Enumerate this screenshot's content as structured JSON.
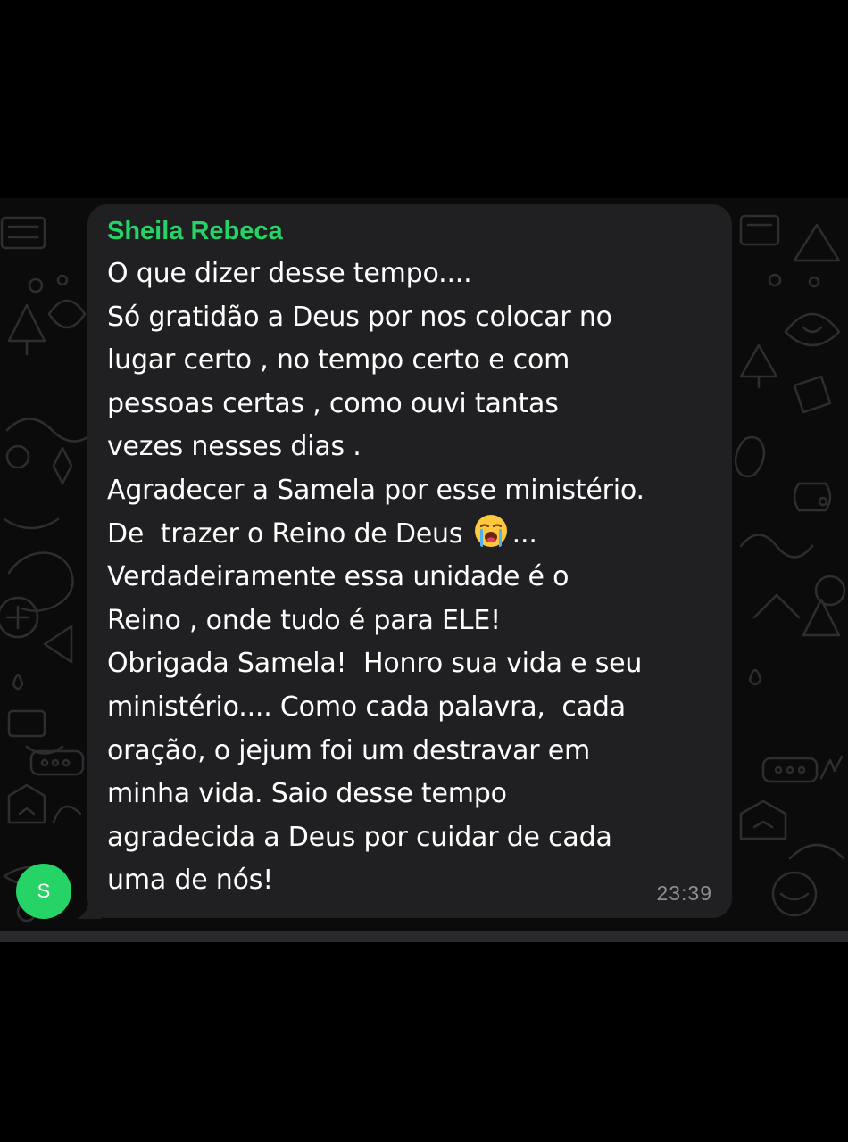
{
  "message": {
    "sender": "Sheila Rebeca",
    "time": "23:39",
    "lines_before_emoji": [
      "O que dizer desse tempo....",
      "Só gratidão a Deus por nos colocar no",
      "lugar certo , no tempo certo e com",
      "pessoas certas , como ouvi tantas",
      "vezes nesses dias .",
      "Agradecer a Samela por esse ministério."
    ],
    "emoji_line_prefix": "De  trazer o Reino de Deus",
    "emoji_icon": "loudly-crying-face-emoji",
    "emoji_line_suffix": "...",
    "lines_after_emoji": [
      "Verdadeiramente essa unidade é o",
      "Reino , onde tudo é para ELE!",
      "Obrigada Samela!  Honro sua vida e seu",
      "ministério.... Como cada palavra,  cada",
      "oração, o jejum foi um destravar em",
      "minha vida. Saio desse tempo",
      "agradecida a Deus por cuidar de cada",
      "uma de nós!"
    ]
  },
  "avatar": {
    "initial": "S",
    "color": "#25d366"
  },
  "colors": {
    "sender_name": "#25d366",
    "bubble": "#202022",
    "chat_background": "#0b0b0b",
    "timestamp": "#8e8e93"
  }
}
